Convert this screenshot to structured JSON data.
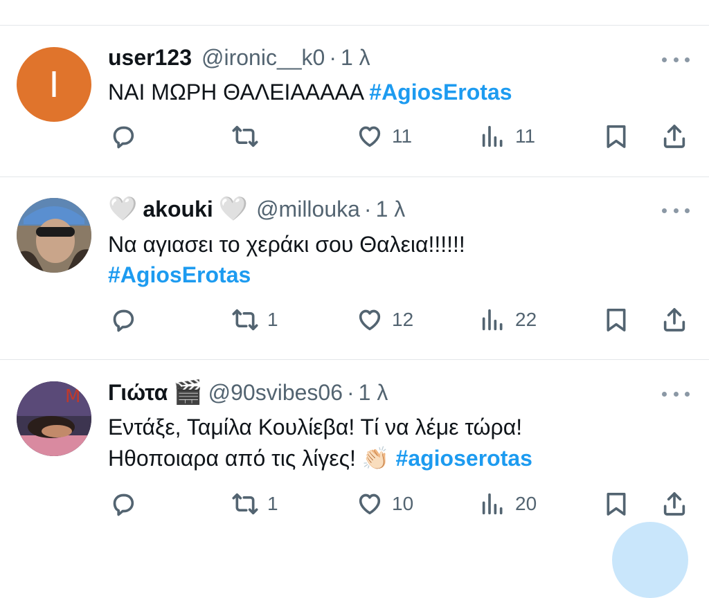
{
  "tweets": [
    {
      "name": "user123",
      "name_suffix_emoji": "",
      "name_prefix_emoji": "",
      "handle": "@ironic__k0",
      "time": "1 λ",
      "avatar_letter": "I",
      "avatar_color": "#e0742c",
      "text_line1": "ΝΑΙ ΜΩΡΗ ΘΑΛΕΙΑΑΑΑΑ ",
      "text_line1_hashtag": "#AgiosErotas",
      "text_line2": "",
      "text_line2_hashtag": "",
      "retweets": "",
      "likes": "11",
      "views": "11"
    },
    {
      "name": "akouki",
      "name_prefix_emoji": "🤍",
      "name_suffix_emoji": "🤍",
      "handle": "@millouka",
      "time": "1 λ",
      "avatar_letter": "",
      "avatar_color": "#6b7b8c",
      "text_line1": "Να αγιασει το χεράκι σου Θαλεια!!!!!!",
      "text_line1_hashtag": "",
      "text_line2": "",
      "text_line2_hashtag": "#AgiosErotas",
      "retweets": "1",
      "likes": "12",
      "views": "22"
    },
    {
      "name": "Γιώτα",
      "name_prefix_emoji": "",
      "name_suffix_emoji": "🎬",
      "handle": "@90svibes06",
      "time": "1 λ",
      "avatar_letter": "",
      "avatar_color": "#4a3a5a",
      "text_line1": "Εντάξε, Ταμίλα Κουλίεβα! Τί να λέμε τώρα!",
      "text_line1_hashtag": "",
      "text_line2": "Ηθοποιαρα από τις λίγες! 👏🏻 ",
      "text_line2_hashtag": "#agioserotas",
      "retweets": "1",
      "likes": "10",
      "views": "20"
    }
  ],
  "icons": {
    "reply": "reply-icon",
    "retweet": "retweet-icon",
    "like": "heart-icon",
    "views": "views-icon",
    "bookmark": "bookmark-icon",
    "share": "share-icon",
    "more": "more-icon"
  },
  "colors": {
    "hashtag": "#1d9bf0",
    "secondary_text": "#536471",
    "divider": "#e3e6e9"
  }
}
